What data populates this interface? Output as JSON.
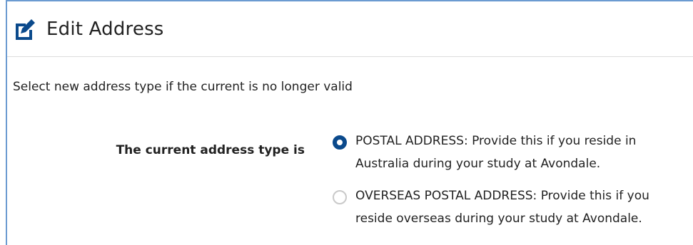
{
  "panel": {
    "title": "Edit Address",
    "icon": "edit-square-icon"
  },
  "instructions": "Select new address type if the current is no longer valid",
  "address_type": {
    "label": "The current address type is",
    "options": [
      {
        "label": "POSTAL ADDRESS: Provide this if you reside in Australia during your study at Avondale.",
        "selected": true
      },
      {
        "label": "OVERSEAS POSTAL ADDRESS: Provide this if you reside overseas during your study at Avondale.",
        "selected": false
      }
    ]
  },
  "colors": {
    "accent": "#0b4a8c",
    "panel_border": "#6b9bd1",
    "divider": "#dddddd",
    "radio_unchecked": "#c9c9c9"
  }
}
